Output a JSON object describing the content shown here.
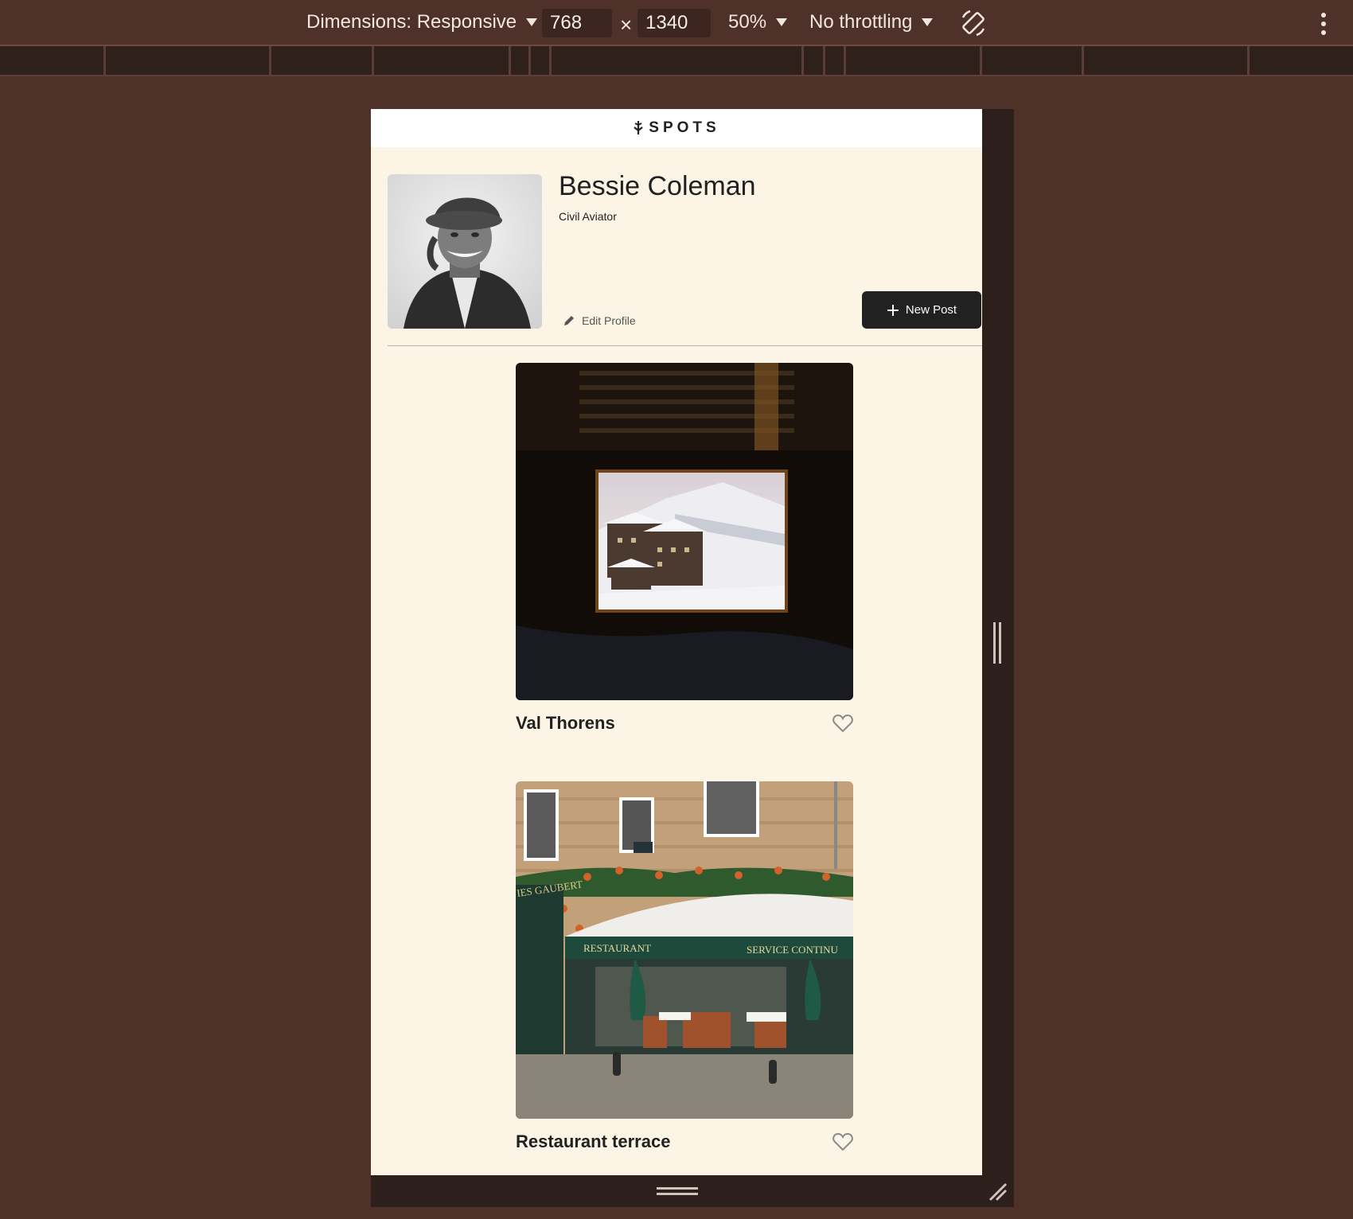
{
  "devtools": {
    "dimensions_label": "Dimensions: Responsive",
    "width_value": "768",
    "times_symbol": "×",
    "height_value": "1340",
    "zoom_label": "50%",
    "throttling_label": "No throttling",
    "icons": [
      "chevron-down-icon",
      "rotate-icon",
      "more-vertical-icon"
    ]
  },
  "header": {
    "logo_text": "SPOTS"
  },
  "profile": {
    "name": "Bessie Coleman",
    "role": "Civil Aviator",
    "edit_label": "Edit Profile",
    "new_post_label": "New Post"
  },
  "cards": [
    {
      "title": "Val Thorens",
      "liked": false
    },
    {
      "title": "Restaurant terrace",
      "liked": false
    }
  ],
  "colors": {
    "page_background": "#fcf5e6",
    "header_background": "#ffffff",
    "button_dark": "#212121",
    "devtools_background": "#4e322a"
  }
}
